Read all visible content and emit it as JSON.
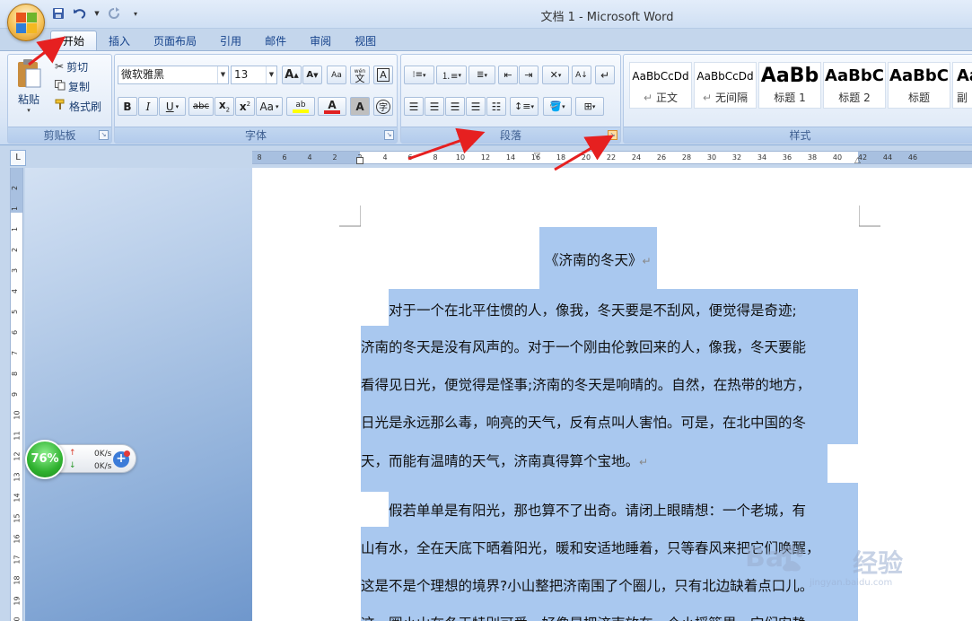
{
  "window": {
    "title": "文档 1 - Microsoft Word"
  },
  "quick_access": {
    "items": [
      "save-icon",
      "undo-icon",
      "redo-icon",
      "customize-icon"
    ]
  },
  "tabs": [
    {
      "label": "开始",
      "active": true
    },
    {
      "label": "插入",
      "active": false
    },
    {
      "label": "页面布局",
      "active": false
    },
    {
      "label": "引用",
      "active": false
    },
    {
      "label": "邮件",
      "active": false
    },
    {
      "label": "审阅",
      "active": false
    },
    {
      "label": "视图",
      "active": false
    }
  ],
  "clipboard": {
    "label": "剪贴板",
    "paste": "粘贴",
    "cut": "剪切",
    "copy": "复制",
    "format_painter": "格式刷"
  },
  "font": {
    "label": "字体",
    "font_name": "微软雅黑",
    "font_size": "13",
    "grow": "A",
    "shrink": "A",
    "phonetic": "wén",
    "phonetic_char": "文",
    "bold": "B",
    "italic": "I",
    "underline": "U",
    "strike": "abc",
    "subscript": "x",
    "superscript": "x",
    "case": "Aa",
    "highlight": "ab",
    "font_color": "A",
    "char_shade": "A",
    "enclose": "字"
  },
  "paragraph": {
    "label": "段落"
  },
  "styles": {
    "label": "样式",
    "items": [
      {
        "sample": "AaBbCcDd",
        "name": "正文"
      },
      {
        "sample": "AaBbCcDd",
        "name": "无间隔"
      },
      {
        "sample": "AaBb",
        "name": "标题 1"
      },
      {
        "sample": "AaBbC",
        "name": "标题 2"
      },
      {
        "sample": "AaBbC",
        "name": "标题"
      },
      {
        "sample": "Aa",
        "name": "副"
      }
    ]
  },
  "ruler": {
    "ticks": [
      "8",
      "6",
      "4",
      "2",
      "2",
      "4",
      "6",
      "8",
      "10",
      "12",
      "14",
      "16",
      "18",
      "20",
      "22",
      "24",
      "26",
      "28",
      "30",
      "32",
      "34",
      "36",
      "38",
      "40",
      "42",
      "44",
      "46"
    ],
    "vticks": [
      "2",
      "1",
      "1",
      "2",
      "3",
      "4",
      "5",
      "6",
      "7",
      "8",
      "9",
      "10",
      "11",
      "12",
      "13",
      "14",
      "15",
      "16",
      "17",
      "18",
      "19",
      "20"
    ],
    "corner": "L"
  },
  "document": {
    "title": "《济南的冬天》",
    "lines": [
      "对于一个在北平住惯的人，像我，冬天要是不刮风，便觉得是奇迹;",
      "济南的冬天是没有风声的。对于一个刚由伦敦回来的人，像我，冬天要能",
      "看得见日光，便觉得是怪事;济南的冬天是响晴的。自然，在热带的地方，",
      "日光是永远那么毒，响亮的天气，反有点叫人害怕。可是，在北中国的冬",
      "天，而能有温晴的天气，济南真得算个宝地。",
      "假若单单是有阳光，那也算不了出奇。请闭上眼睛想：一个老城，有",
      "山有水，全在天底下晒着阳光，暖和安适地睡着，只等春风来把它们唤醒，",
      "这是不是个理想的境界?小山整把济南围了个圈儿，只有北边缺着点口儿。",
      "这一圈小山在冬天特别可爱，好像是把济南放在一个小摇篮里，它们安静"
    ],
    "pilcrow": "↵"
  },
  "net_widget": {
    "percent": "76%",
    "up": "0K/s",
    "down": "0K/s"
  },
  "watermark": {
    "brand": "Bai",
    "suffix": "经验",
    "url": "jingyan.baidu.com"
  }
}
